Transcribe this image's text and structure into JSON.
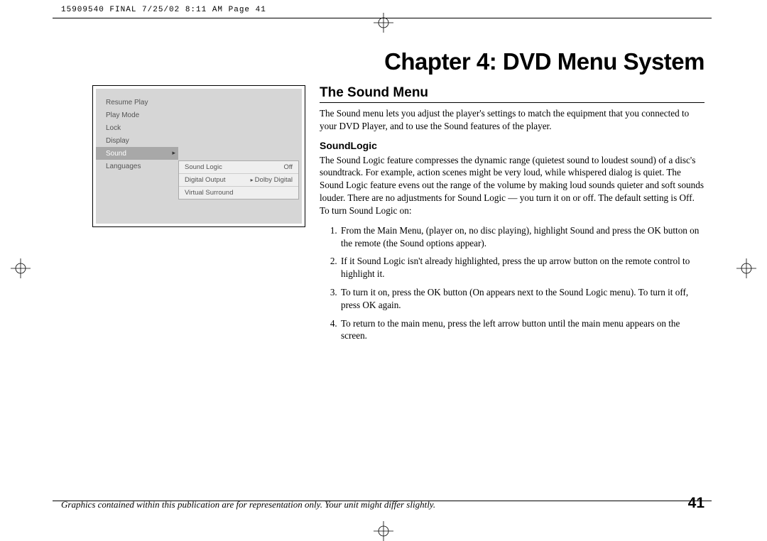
{
  "header": "15909540 FINAL  7/25/02  8:11 AM  Page 41",
  "chapter_title": "Chapter 4: DVD Menu System",
  "screenshot": {
    "menu": [
      "Resume Play",
      "Play Mode",
      "Lock",
      "Display",
      "Sound",
      "Languages"
    ],
    "selected_index": 4,
    "submenu": [
      {
        "label": "Sound Logic",
        "value": "Off",
        "arrow": false
      },
      {
        "label": "Digital Output",
        "value": "Dolby Digital",
        "arrow": true
      },
      {
        "label": "Virtual Surround",
        "value": "",
        "arrow": false
      }
    ]
  },
  "section": {
    "title": "The Sound Menu",
    "intro": "The Sound menu lets you adjust the player's settings to match the equipment that you connected to your DVD Player, and to use the Sound features of the player.",
    "sub_heading": "SoundLogic",
    "body": "The Sound Logic feature compresses the dynamic range (quietest sound to loudest sound) of a disc's soundtrack. For example, action scenes might be very loud, while whispered dialog is quiet. The Sound Logic feature evens out the range of the volume by making loud sounds quieter and soft sounds louder. There are no adjustments for Sound Logic — you turn it on or off. The default setting is Off. To turn Sound Logic on:",
    "steps": [
      "From the Main Menu, (player on, no disc playing), highlight Sound and press the OK button on the remote (the Sound options appear).",
      "If it Sound Logic isn't already highlighted, press the up arrow button on the remote control to highlight it.",
      "To turn it on, press the OK button (On appears next to the Sound Logic menu). To turn it off, press OK again.",
      "To return to the main menu, press the left arrow button until the main menu appears on the screen."
    ]
  },
  "footer": {
    "note": "Graphics contained within this publication are for representation only. Your unit might differ slightly.",
    "page": "41"
  }
}
